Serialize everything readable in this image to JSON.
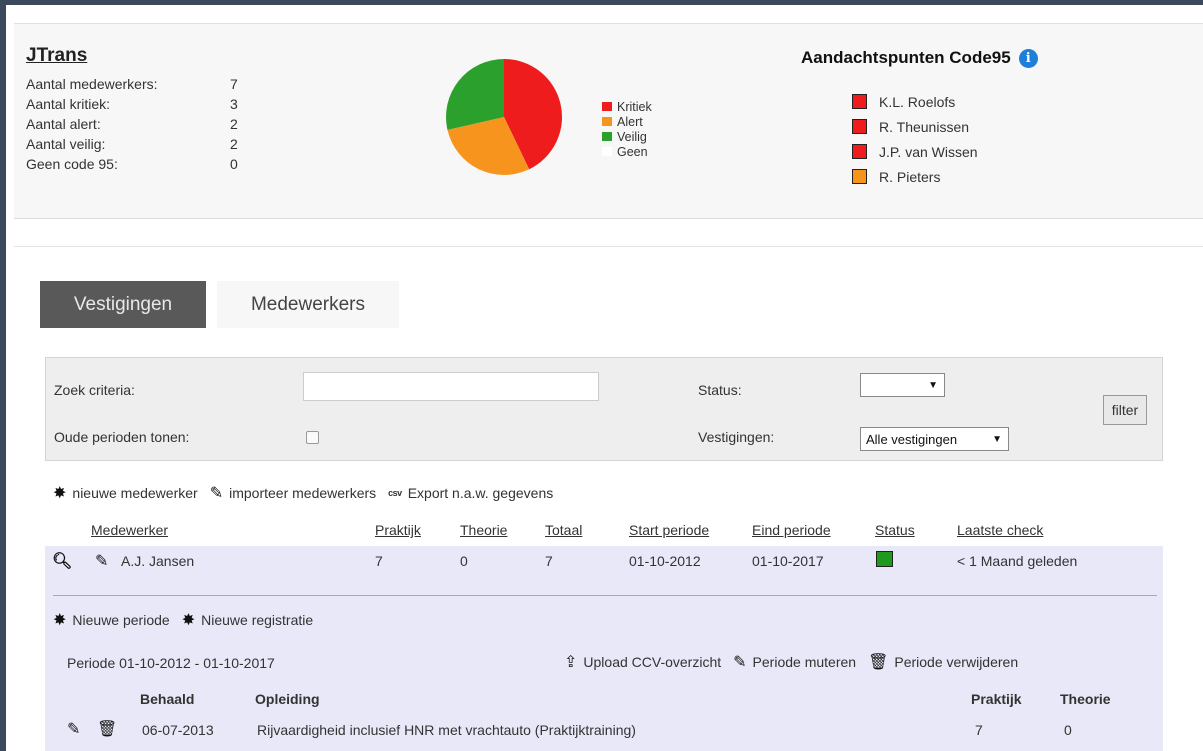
{
  "company": {
    "name": "JTrans",
    "stats": [
      {
        "label": "Aantal medewerkers:",
        "value": "7"
      },
      {
        "label": "Aantal kritiek:",
        "value": "3"
      },
      {
        "label": "Aantal alert:",
        "value": "2"
      },
      {
        "label": "Aantal veilig:",
        "value": "2"
      },
      {
        "label": "Geen code 95:",
        "value": "0"
      }
    ]
  },
  "chart_data": {
    "type": "pie",
    "categories": [
      "Kritiek",
      "Alert",
      "Veilig",
      "Geen"
    ],
    "values": [
      3,
      2,
      2,
      0
    ],
    "colors": [
      "#ee1c1c",
      "#f7941d",
      "#2ca02c",
      "#ffffff"
    ],
    "legend_position": "right"
  },
  "aandacht": {
    "title": "Aandachtspunten Code95",
    "items": [
      {
        "name": "K.L. Roelofs",
        "color": "#ee1c1c"
      },
      {
        "name": "R. Theunissen",
        "color": "#ee1c1c"
      },
      {
        "name": "J.P. van Wissen",
        "color": "#ee1c1c"
      },
      {
        "name": "R. Pieters",
        "color": "#f7941d"
      }
    ]
  },
  "tabs": {
    "vestigingen": "Vestigingen",
    "medewerkers": "Medewerkers"
  },
  "filter": {
    "zoek_label": "Zoek criteria:",
    "zoek_value": "",
    "oude_label": "Oude perioden tonen:",
    "status_label": "Status:",
    "status_value": "",
    "vestigingen_label": "Vestigingen:",
    "vestigingen_value": "Alle vestigingen",
    "button": "filter"
  },
  "actions": {
    "nieuwe_medewerker": "nieuwe medewerker",
    "importeer": "importeer medewerkers",
    "csv_icon": "csv",
    "export": "Export n.a.w. gegevens"
  },
  "table": {
    "headers": {
      "medewerker": "Medewerker",
      "praktijk": "Praktijk",
      "theorie": "Theorie",
      "totaal": "Totaal",
      "start": "Start periode",
      "eind": "Eind periode",
      "status": "Status",
      "laatste": "Laatste check"
    },
    "row": {
      "medewerker": "A.J. Jansen",
      "praktijk": "7",
      "theorie": "0",
      "totaal": "7",
      "start": "01-10-2012",
      "eind": "01-10-2017",
      "status_color": "#1f9a1f",
      "laatste": "< 1 Maand geleden"
    }
  },
  "detail": {
    "nieuwe_periode": "Nieuwe periode",
    "nieuwe_registratie": "Nieuwe registratie",
    "periode": "Periode 01-10-2012 - 01-10-2017",
    "upload": "Upload CCV-overzicht",
    "muteren": "Periode muteren",
    "verwijderen": "Periode verwijderen",
    "headers": {
      "behaald": "Behaald",
      "opleiding": "Opleiding",
      "praktijk": "Praktijk",
      "theorie": "Theorie"
    },
    "row": {
      "behaald": "06-07-2013",
      "opleiding": "Rijvaardigheid inclusief HNR met vrachtauto (Praktijktraining)",
      "praktijk": "7",
      "theorie": "0"
    }
  }
}
